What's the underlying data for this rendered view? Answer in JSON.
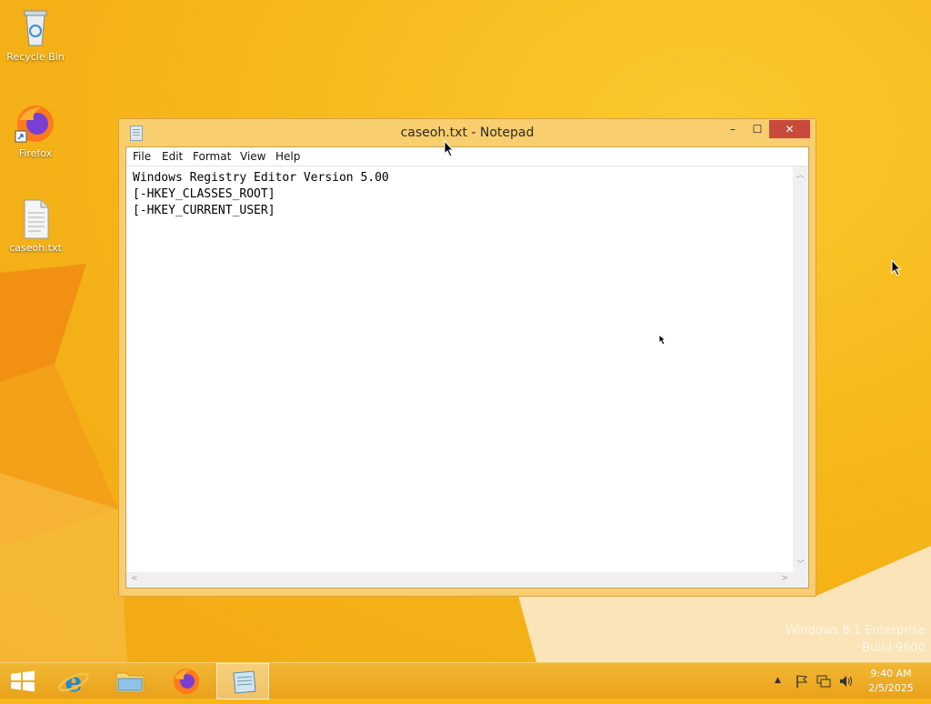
{
  "desktop": {
    "icons": [
      {
        "label": "Recycle Bin",
        "icon": "recycle-bin-icon"
      },
      {
        "label": "Firefox",
        "icon": "firefox-icon"
      },
      {
        "label": "caseoh.txt",
        "icon": "text-file-icon"
      }
    ],
    "watermark": {
      "line1": "Windows 8.1 Enterprise",
      "line2": "Build 9600"
    }
  },
  "notepad": {
    "title": "caseoh.txt - Notepad",
    "menu": [
      "File",
      "Edit",
      "Format",
      "View",
      "Help"
    ],
    "content": "Windows Registry Editor Version 5.00\n[-HKEY_CLASSES_ROOT]\n[-HKEY_CURRENT_USER]",
    "buttons": {
      "minimize": "–",
      "maximize": "☐",
      "close": "✕"
    }
  },
  "taskbar": {
    "apps": [
      {
        "name": "Start",
        "icon": "windows-logo-icon"
      },
      {
        "name": "Internet Explorer",
        "icon": "internet-explorer-icon"
      },
      {
        "name": "File Explorer",
        "icon": "file-explorer-icon"
      },
      {
        "name": "Firefox",
        "icon": "firefox-icon"
      },
      {
        "name": "Notepad",
        "icon": "notepad-icon",
        "active": true
      }
    ],
    "tray": {
      "show_hidden": "▲",
      "time": "9:40 AM",
      "date": "2/5/2025"
    }
  },
  "colors": {
    "desktop": "#f7b61a",
    "window_frame": "#f9ce6e",
    "close_button": "#c74a3a"
  }
}
